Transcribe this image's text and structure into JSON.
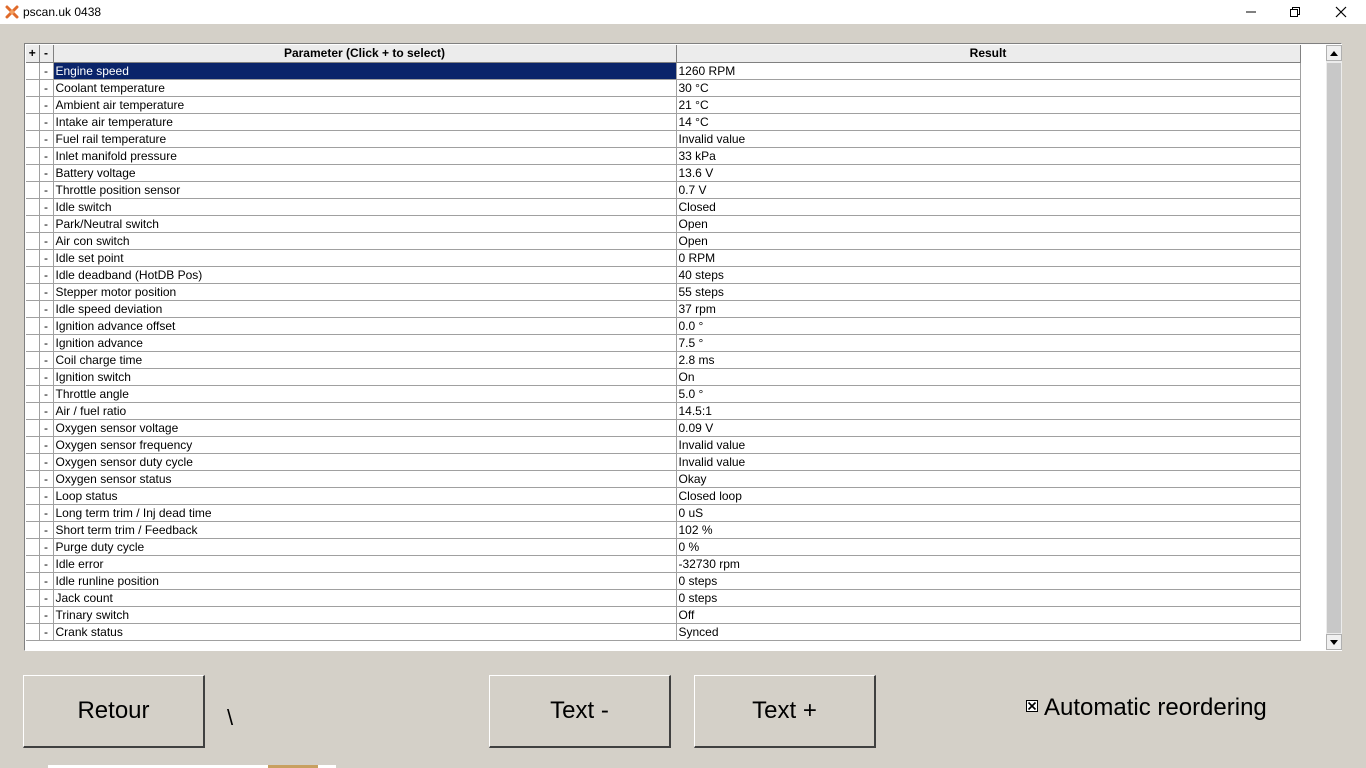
{
  "window": {
    "title": "pscan.uk 0438",
    "icon": "app-logo-icon",
    "controls": [
      "minimize-icon",
      "maximize-icon",
      "close-icon"
    ]
  },
  "grid": {
    "headers": {
      "plus": "+",
      "minus": "-",
      "parameter": "Parameter (Click + to select)",
      "result": "Result"
    },
    "selected_index": 0,
    "rows": [
      {
        "sign": "-",
        "parameter": "Engine speed",
        "result": "1260 RPM"
      },
      {
        "sign": "-",
        "parameter": "Coolant temperature",
        "result": "30 °C"
      },
      {
        "sign": "-",
        "parameter": "Ambient air temperature",
        "result": "21 °C"
      },
      {
        "sign": "-",
        "parameter": "Intake air temperature",
        "result": "14 °C"
      },
      {
        "sign": "-",
        "parameter": "Fuel rail temperature",
        "result": "Invalid value"
      },
      {
        "sign": "-",
        "parameter": "Inlet manifold pressure",
        "result": "33 kPa"
      },
      {
        "sign": "-",
        "parameter": "Battery voltage",
        "result": "13.6 V"
      },
      {
        "sign": "-",
        "parameter": "Throttle position sensor",
        "result": "0.7 V"
      },
      {
        "sign": "-",
        "parameter": "Idle switch",
        "result": "Closed"
      },
      {
        "sign": "-",
        "parameter": "Park/Neutral switch",
        "result": "Open"
      },
      {
        "sign": "-",
        "parameter": "Air con switch",
        "result": "Open"
      },
      {
        "sign": "-",
        "parameter": "Idle set point",
        "result": "0 RPM"
      },
      {
        "sign": "-",
        "parameter": "Idle deadband (HotDB Pos)",
        "result": "40 steps"
      },
      {
        "sign": "-",
        "parameter": "Stepper motor position",
        "result": "55 steps"
      },
      {
        "sign": "-",
        "parameter": "Idle speed deviation",
        "result": "37 rpm"
      },
      {
        "sign": "-",
        "parameter": "Ignition advance offset",
        "result": "0.0 °"
      },
      {
        "sign": "-",
        "parameter": "Ignition advance",
        "result": "7.5 °"
      },
      {
        "sign": "-",
        "parameter": "Coil charge time",
        "result": "2.8 ms"
      },
      {
        "sign": "-",
        "parameter": "Ignition switch",
        "result": "On"
      },
      {
        "sign": "-",
        "parameter": "Throttle angle",
        "result": "5.0 °"
      },
      {
        "sign": "-",
        "parameter": "Air / fuel ratio",
        "result": "14.5:1"
      },
      {
        "sign": "-",
        "parameter": "Oxygen sensor voltage",
        "result": "0.09 V"
      },
      {
        "sign": "-",
        "parameter": "Oxygen sensor frequency",
        "result": "Invalid value"
      },
      {
        "sign": "-",
        "parameter": "Oxygen sensor duty cycle",
        "result": "Invalid value"
      },
      {
        "sign": "-",
        "parameter": "Oxygen sensor status",
        "result": "Okay"
      },
      {
        "sign": "-",
        "parameter": "Loop status",
        "result": "Closed loop"
      },
      {
        "sign": "-",
        "parameter": "Long term trim / Inj dead time",
        "result": "0 uS"
      },
      {
        "sign": "-",
        "parameter": "Short term trim / Feedback",
        "result": "102 %"
      },
      {
        "sign": "-",
        "parameter": "Purge duty cycle",
        "result": "0 %"
      },
      {
        "sign": "-",
        "parameter": "Idle error",
        "result": "-32730 rpm"
      },
      {
        "sign": "-",
        "parameter": "Idle runline position",
        "result": "0 steps"
      },
      {
        "sign": "-",
        "parameter": "Jack count",
        "result": "0 steps"
      },
      {
        "sign": "-",
        "parameter": "Trinary switch",
        "result": "Off"
      },
      {
        "sign": "-",
        "parameter": "Crank status",
        "result": "Synced"
      }
    ]
  },
  "footer": {
    "back_label": "Retour",
    "separator": "\\",
    "text_minus_label": "Text -",
    "text_plus_label": "Text +",
    "auto_reorder_label": "Automatic reordering",
    "auto_reorder_checked": true
  }
}
